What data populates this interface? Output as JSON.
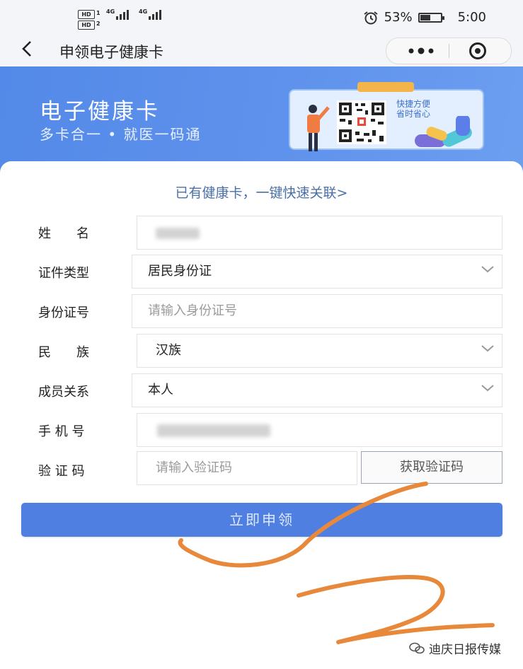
{
  "status_bar": {
    "sim1": "HD",
    "sim2": "HD",
    "sim1_num": "1",
    "sim2_num": "2",
    "net1": "4G",
    "net2": "4G",
    "battery_percent": "53%",
    "battery_level": 0.53,
    "time": "5:00"
  },
  "nav": {
    "back_icon": "chevron-left",
    "title": "申领电子健康卡",
    "more_icon": "dots",
    "close_icon": "target-circle"
  },
  "banner": {
    "title": "电子健康卡",
    "subtitle": "多卡合一 • 就医一码通",
    "card_text_line1": "快捷方便",
    "card_text_line2": "省时省心"
  },
  "form": {
    "link_text": "已有健康卡，一键快速关联>",
    "name": {
      "label": "姓　　名",
      "value": ""
    },
    "id_type": {
      "label": "证件类型",
      "value": "居民身份证"
    },
    "id_number": {
      "label": "身份证号",
      "placeholder": "请输入身份证号"
    },
    "ethnicity": {
      "label": "民　　族",
      "value": "汉族"
    },
    "relation": {
      "label": "成员关系",
      "value": "本人"
    },
    "phone": {
      "label": "手 机 号",
      "value": ""
    },
    "code": {
      "label": "验 证 码",
      "placeholder": "请输入验证码",
      "button": "获取验证码"
    },
    "submit": "立即申领"
  },
  "watermark": "迪庆日报传媒",
  "colors": {
    "banner": "#5389e8",
    "submit": "#4f7fe0",
    "link": "#4a6fa5",
    "scribble": "#e8883a"
  }
}
